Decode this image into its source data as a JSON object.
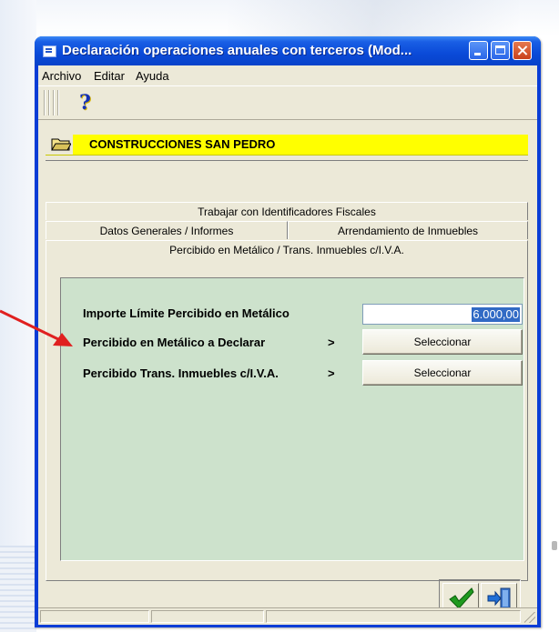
{
  "window": {
    "title": "Declaración operaciones anuales con terceros (Mod...",
    "colors": {
      "titlebar": "#0a4ad8",
      "client": "#ece9d8",
      "panel": "#cde2cc",
      "company_bg": "#ffff00"
    }
  },
  "menu": {
    "items": [
      {
        "label": "Archivo"
      },
      {
        "label": "Editar"
      },
      {
        "label": "Ayuda"
      }
    ]
  },
  "toolbar": {
    "help_icon": "question-mark-icon",
    "help_glyph": "?"
  },
  "company": {
    "name": "CONSTRUCCIONES SAN PEDRO",
    "icon": "folder-icon"
  },
  "tabs": {
    "row1": {
      "label": "Trabajar con Identificadores Fiscales"
    },
    "row2": [
      {
        "label": "Datos Generales / Informes"
      },
      {
        "label": "Arrendamiento de Inmuebles"
      }
    ],
    "active": {
      "label": "Percibido en Metálico / Trans. Inmuebles c/I.V.A."
    }
  },
  "form": {
    "limit": {
      "label": "Importe Límite Percibido en Metálico",
      "value": "6.000,00"
    },
    "rows": [
      {
        "label": "Percibido en Metálico a Declarar",
        "arrow": ">",
        "button": "Seleccionar"
      },
      {
        "label": "Percibido Trans. Inmuebles c/I.V.A.",
        "arrow": ">",
        "button": "Seleccionar"
      }
    ]
  },
  "actions": {
    "ok_icon": "checkmark-icon",
    "exit_icon": "exit-door-icon"
  },
  "annotation": {
    "arrow_color": "#e02020"
  }
}
